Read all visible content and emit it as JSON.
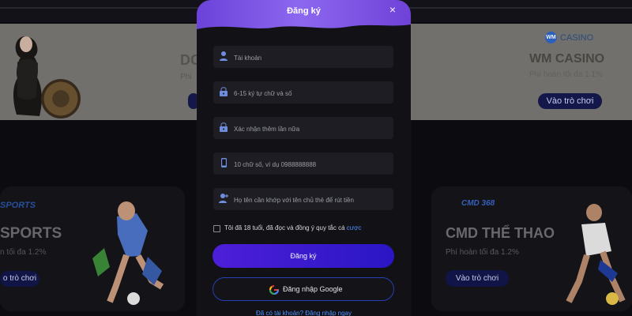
{
  "modal": {
    "title": "Đăng ký",
    "close_icon": "close-icon",
    "fields": [
      {
        "icon": "user-icon",
        "placeholder": "Tài khoản"
      },
      {
        "icon": "lock-icon",
        "placeholder": "6-15 ký tự chữ và số"
      },
      {
        "icon": "lock-icon",
        "placeholder": "Xác nhận thêm lần nữa"
      },
      {
        "icon": "phone-icon",
        "placeholder": "10 chữ số, ví dụ 0988888888"
      },
      {
        "icon": "user-plus-icon",
        "placeholder": "Họ tên cần khớp với tên chủ thẻ để rút tiền"
      }
    ],
    "terms": {
      "text": "Tôi đã 18 tuổi, đã đọc và đồng ý quy tắc cá",
      "link": "cược"
    },
    "submit": "Đăng ký",
    "google_login": "Đăng nhập Google",
    "login_prompt": "Đã có tài khoản? Đăng nhập ngay"
  },
  "background": {
    "banner_left": {
      "title": "DC",
      "cashback": "Phi",
      "button": ""
    },
    "banner_right": {
      "logo_text": "CASINO",
      "title": "WM CASINO",
      "cashback": "Phí hoàn tối đa 1.1%",
      "button": "Vào trò chơi"
    },
    "card_left": {
      "logo": "SPORTS",
      "title": "SPORTS",
      "cashback": "n tối đa 1.2%",
      "button": "o trò chơi"
    },
    "card_right": {
      "logo": "CMD 368",
      "title": "CMD THỂ THAO",
      "cashback": "Phí hoàn tối đa 1.2%",
      "button": "Vào trò chơi"
    }
  },
  "colors": {
    "header_accent": "#7b55e7",
    "link": "#4e92ff",
    "primary_button": "#3718cf"
  }
}
